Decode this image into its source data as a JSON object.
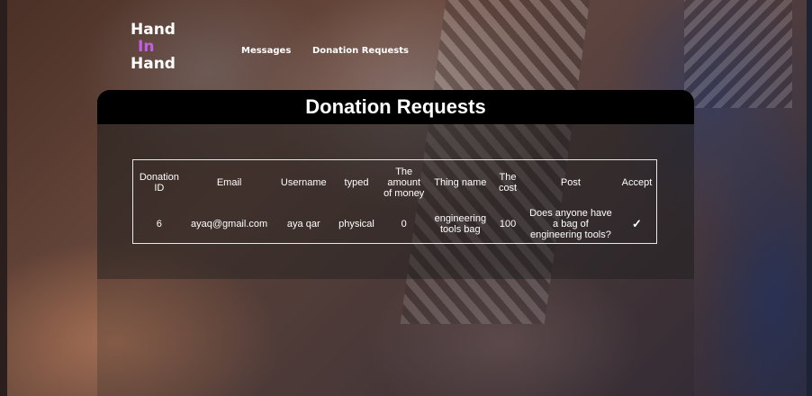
{
  "logo": {
    "line1": "Hand",
    "line2": "In",
    "line3": "Hand",
    "accent": "#c45ee6"
  },
  "nav": {
    "messages": "Messages",
    "donation_requests": "Donation Requests"
  },
  "page": {
    "title": "Donation Requests"
  },
  "table": {
    "headers": [
      "Donation ID",
      "Email",
      "Username",
      "typed",
      "The amount of money",
      "Thing name",
      "The cost",
      "Post",
      "Accept"
    ],
    "rows": [
      {
        "id": "6",
        "email": "ayaq@gmail.com",
        "username": "aya qar",
        "typed": "physical",
        "amount": "0",
        "thing": "engineering tools bag",
        "cost": "100",
        "post": "Does anyone have a bag of engineering tools?",
        "accept": "✓",
        "accept_icon": "check-icon"
      }
    ]
  }
}
